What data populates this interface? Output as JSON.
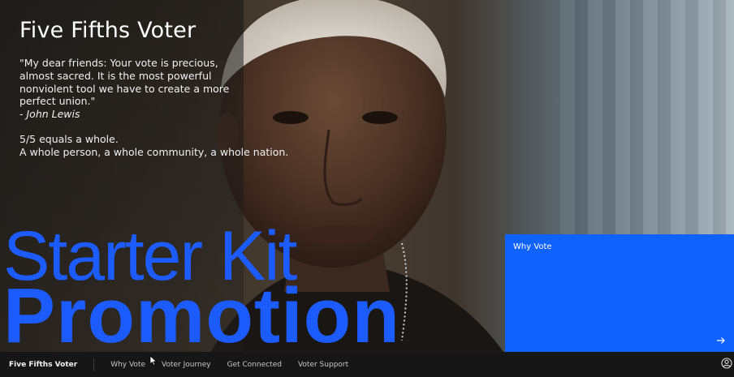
{
  "hero": {
    "title": "Five Fifths Voter",
    "quote_lines": [
      "\"My dear friends: Your vote is precious,",
      "almost sacred. It is the most powerful",
      "nonviolent tool we have to create a more",
      "perfect union.\""
    ],
    "quote_author": "- John Lewis",
    "tagline_1": "5/5 equals a whole.",
    "tagline_2": "A whole person, a whole community, a whole nation."
  },
  "overlay": {
    "line_1": "Starter Kit",
    "line_2": "Promotion",
    "color": "#1c5cff"
  },
  "card": {
    "label": "Why Vote",
    "icon": "arrow-right-icon",
    "color": "#0f62fe"
  },
  "nav": {
    "brand": "Five Fifths Voter",
    "items": [
      "Why Vote",
      "Voter Journey",
      "Get Connected",
      "Voter Support"
    ],
    "user_icon": "user-avatar-icon"
  }
}
